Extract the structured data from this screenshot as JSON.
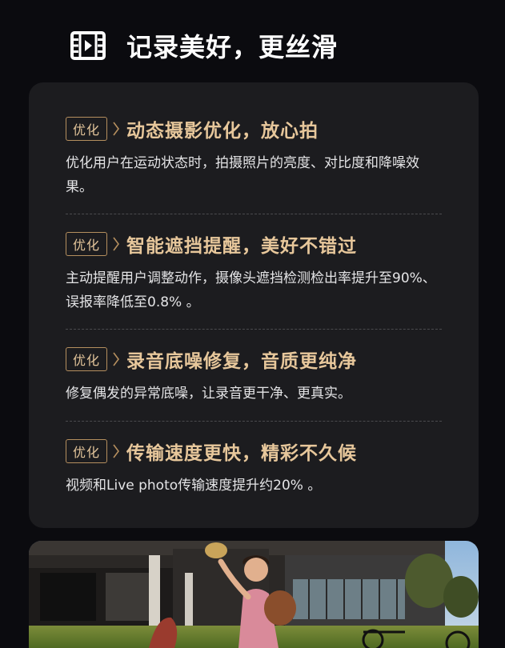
{
  "header": {
    "title": "记录美好，更丝滑",
    "icon": "film-icon"
  },
  "features": [
    {
      "badge": "优化",
      "title": "动态摄影优化，放心拍",
      "desc": "优化用户在运动状态时，拍摄照片的亮度、对比度和降噪效果。"
    },
    {
      "badge": "优化",
      "title": "智能遮挡提醒，美好不错过",
      "desc": "主动提醒用户调整动作，摄像头遮挡检测检出率提升至90%、误报率降低至0.8% 。"
    },
    {
      "badge": "优化",
      "title": "录音底噪修复，音质更纯净",
      "desc": "修复偶发的异常底噪，让录音更干净、更真实。"
    },
    {
      "badge": "优化",
      "title": "传输速度更快，精彩不久候",
      "desc": "视频和Live photo传输速度提升约20% 。"
    }
  ],
  "colors": {
    "accent": "#e7c79b",
    "badge_border": "#b58f5e",
    "card_bg": "#1c1c1f",
    "page_bg": "#0b0b0f"
  }
}
